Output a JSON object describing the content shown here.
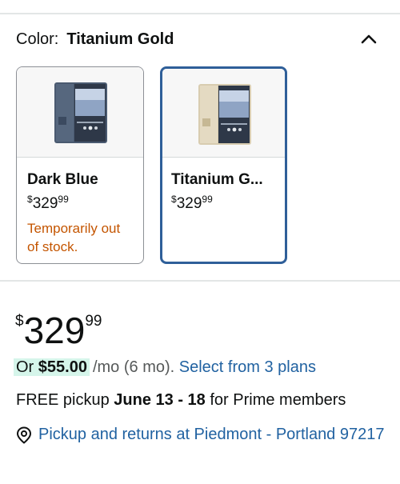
{
  "color_selector": {
    "label": "Color:",
    "selected": "Titanium Gold",
    "options": [
      {
        "name": "Dark Blue",
        "price_dollars": "329",
        "price_cents": "99",
        "currency": "$",
        "stock_note": "Temporarily out of stock.",
        "selected": false,
        "body_color": "#4a5a70"
      },
      {
        "name": "Titanium G...",
        "price_dollars": "329",
        "price_cents": "99",
        "currency": "$",
        "selected": true,
        "body_color": "#d8ccb0"
      }
    ]
  },
  "price": {
    "currency": "$",
    "dollars": "329",
    "cents": "99"
  },
  "financing": {
    "prefix": "Or",
    "amount": "$55.00",
    "term": "/mo (6 mo).",
    "link": "Select from 3 plans"
  },
  "pickup": {
    "text_before": "FREE pickup",
    "dates": "June 13 - 18",
    "text_after": "for Prime members"
  },
  "location": {
    "link": "Pickup and returns at Piedmont - Portland 97217"
  },
  "colors": {
    "link": "#2162a1",
    "selected_border": "#2f5f99",
    "stock_warning": "#c45500",
    "financing_highlight": "#d5f5ea"
  }
}
